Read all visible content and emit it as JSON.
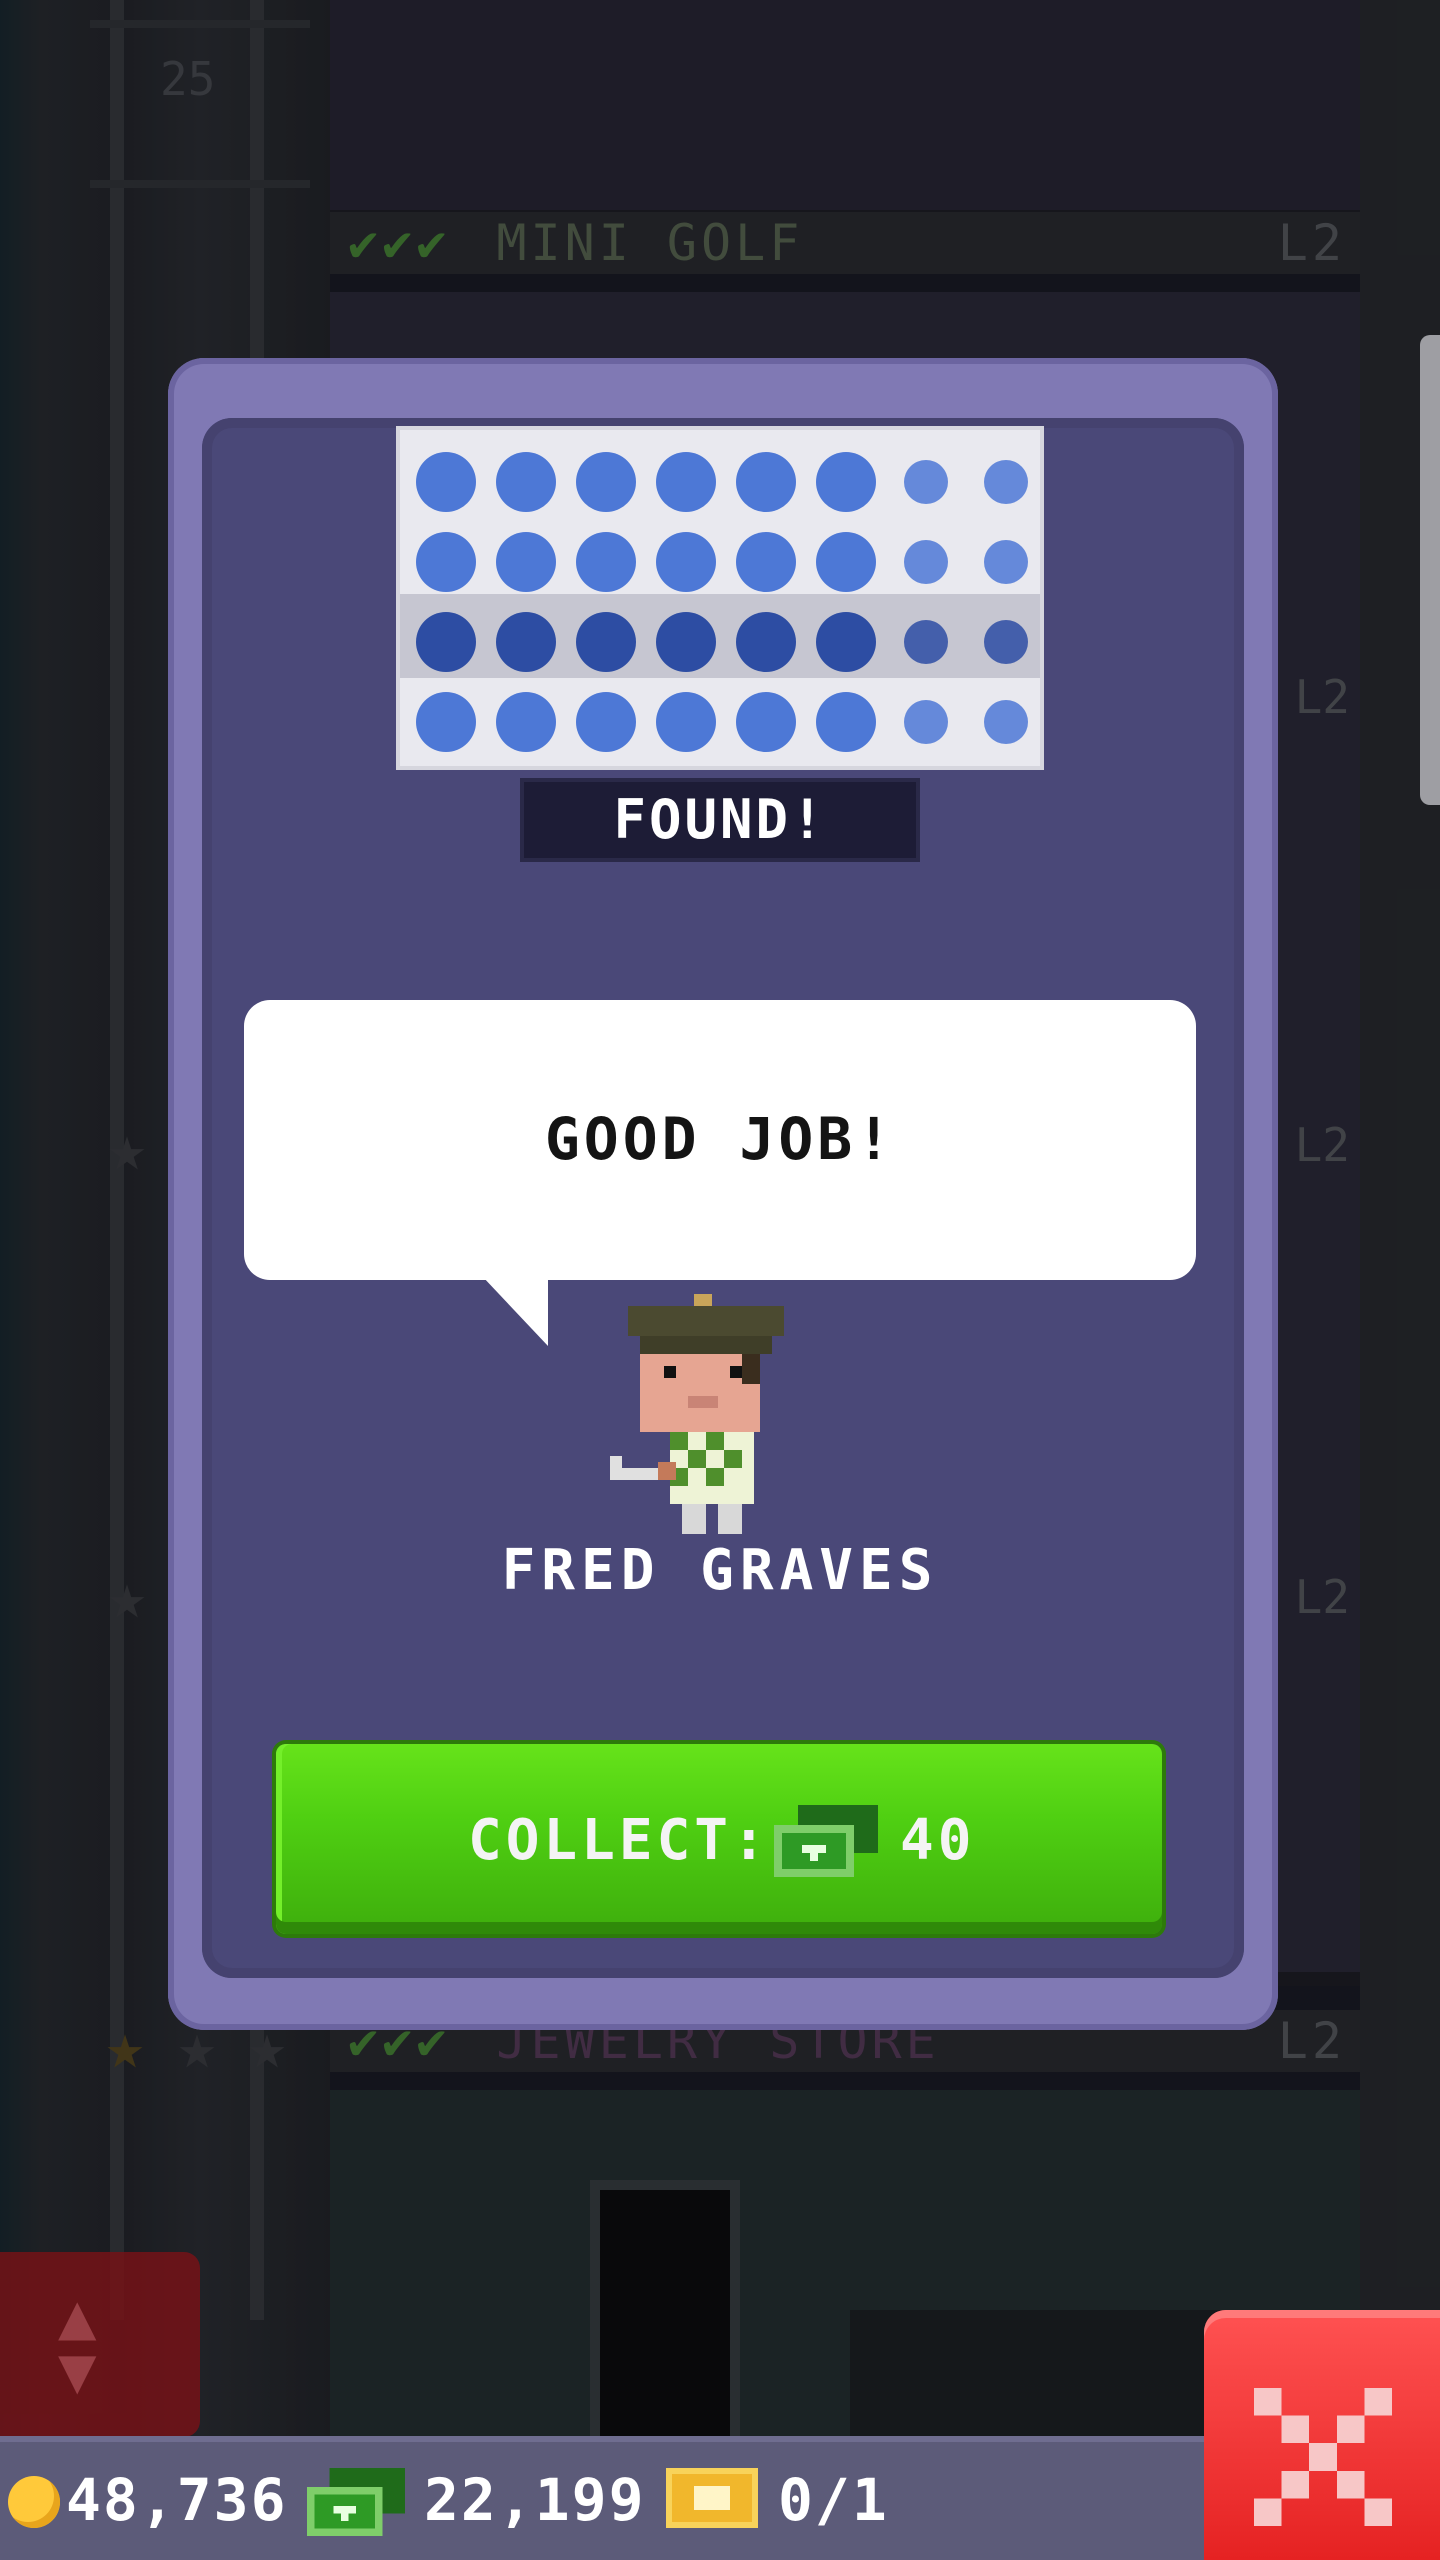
{
  "background": {
    "floors": [
      {
        "name": "MINI GOLF",
        "level": "L2",
        "checks": "✔✔✔"
      },
      {
        "name": "JEWELRY STORE",
        "level": "L2",
        "checks": "✔✔✔"
      }
    ],
    "floor_number": "25",
    "side_level_tags": [
      "L2",
      "L2",
      "L2"
    ]
  },
  "modal": {
    "found_label": "FOUND!",
    "speech": "GOOD JOB!",
    "character_name": "FRED GRAVES",
    "collect_label": "COLLECT:",
    "collect_amount": "40"
  },
  "hud": {
    "coins": "48,736",
    "bux": "22,199",
    "tickets": "0/1"
  },
  "icons": {
    "coin": "coin-icon",
    "bux": "tower-bux-icon",
    "ticket": "golden-ticket-icon",
    "close": "close-icon",
    "elevator": "elevator-arrows-icon"
  },
  "colors": {
    "modal_frame": "#8079b4",
    "modal_body": "#4a4878",
    "collect_button": "#4fcf12",
    "close_button": "#e52222",
    "hud_bar": "#5c5b79"
  }
}
